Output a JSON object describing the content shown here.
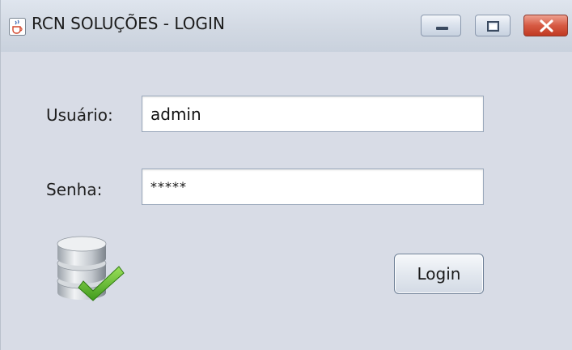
{
  "window": {
    "title": "RCN SOLUÇÕES - LOGIN",
    "app_icon": "java-coffee-cup-icon",
    "controls": {
      "minimize_icon": "minimize-icon",
      "maximize_icon": "maximize-icon",
      "close_icon": "close-icon"
    }
  },
  "form": {
    "username_label": "Usuário:",
    "username_value": "admin",
    "password_label": "Senha:",
    "password_value": "*****",
    "database_icon": "database-check-icon",
    "login_button_label": "Login"
  },
  "colors": {
    "window_background": "#d8dce6",
    "close_button": "#d65a43",
    "check_mark": "#5ab82a"
  }
}
